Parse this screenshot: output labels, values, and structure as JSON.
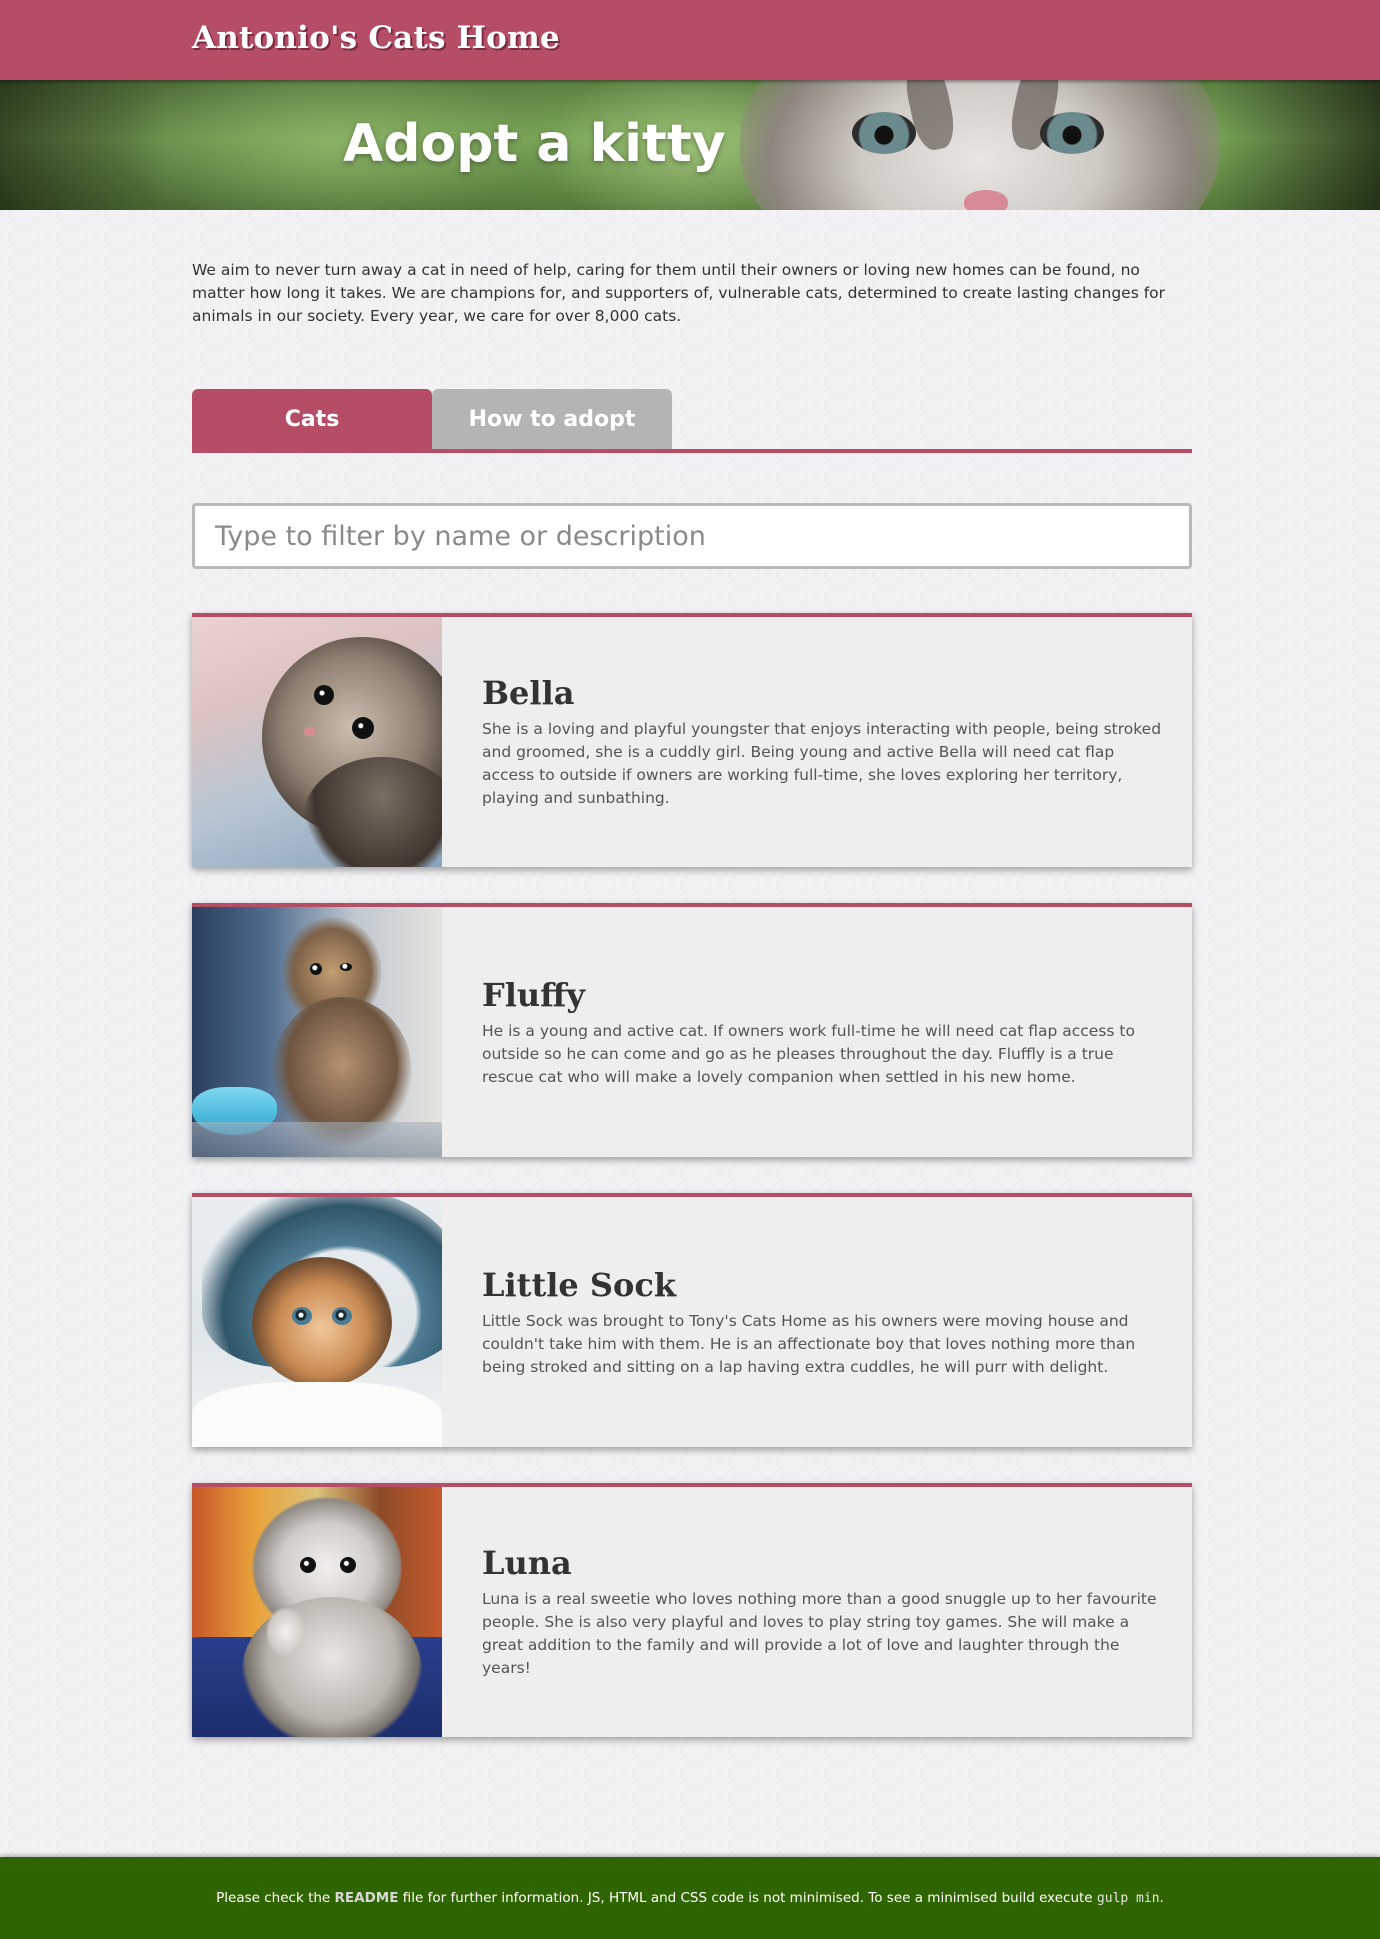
{
  "header": {
    "site_title": "Antonio's Cats Home"
  },
  "hero": {
    "title": "Adopt a kitty"
  },
  "intro": {
    "text": "We aim to never turn away a cat in need of help, caring for them until their owners or loving new homes can be found, no matter how long it takes. We are champions for, and supporters of, vulnerable cats, determined to create lasting changes for animals in our society. Every year, we care for over 8,000 cats."
  },
  "tabs": [
    {
      "label": "Cats",
      "active": true
    },
    {
      "label": "How to adopt",
      "active": false
    }
  ],
  "search": {
    "placeholder": "Type to filter by name or description",
    "value": ""
  },
  "cats": [
    {
      "name": "Bella",
      "description": "She is a loving and playful youngster that enjoys interacting with people, being stroked and groomed, she is a cuddly girl. Being young and active Bella will need cat flap access to outside if owners are working full-time, she loves exploring her territory, playing and sunbathing."
    },
    {
      "name": "Fluffy",
      "description": "He is a young and active cat. If owners work full-time he will need cat flap access to outside so he can come and go as he pleases throughout the day. Fluffly is a true rescue cat who will make a lovely companion when settled in his new home."
    },
    {
      "name": "Little Sock",
      "description": "Little Sock was brought to Tony's Cats Home as his owners were moving house and couldn't take him with them. He is an affectionate boy that loves nothing more than being stroked and sitting on a lap having extra cuddles, he will purr with delight."
    },
    {
      "name": "Luna",
      "description": "Luna is a real sweetie who loves nothing more than a good snuggle up to her favourite people. She is also very playful and loves to play string toy games. She will make a great addition to the family and will provide a lot of love and laughter through the years!"
    }
  ],
  "footer": {
    "pre": "Please check the",
    "readme": "README",
    "mid": "file for further information. JS, HTML and CSS code is not minimised. To see a minimised build execute",
    "command": "gulp min",
    "post": "."
  },
  "colors": {
    "brand": "#b64d67",
    "footer": "#2f6500",
    "tab_inactive": "#b4b4b4"
  }
}
